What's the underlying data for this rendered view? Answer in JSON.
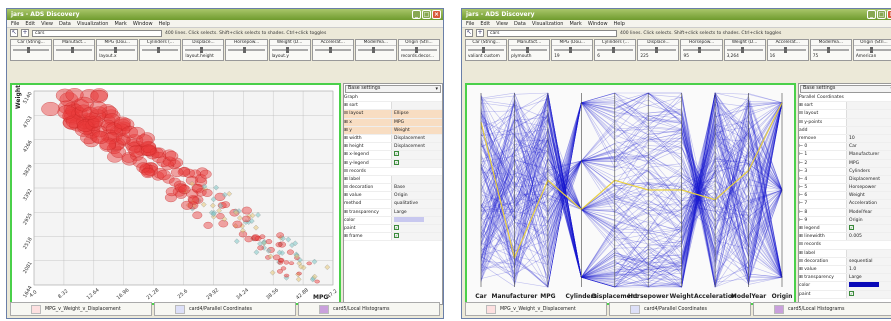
{
  "left": {
    "title": "jars - ADS Discovery",
    "menu": [
      "File",
      "Edit",
      "View",
      "Data",
      "Visualization",
      "Mark",
      "Window",
      "Help"
    ],
    "search": "cars",
    "hint": "400 lines. Click selects. Shift+click selects to shades. Ctrl+click toggles",
    "columns": [
      {
        "name": "Car (String...",
        "value": ""
      },
      {
        "name": "Manufact...",
        "value": ""
      },
      {
        "name": "MPG (Dou...",
        "value": "layout.x"
      },
      {
        "name": "Cylinders (...",
        "value": ""
      },
      {
        "name": "Displace...",
        "value": "layout.height"
      },
      {
        "name": "Horsepow...",
        "value": ""
      },
      {
        "name": "Weight (D...",
        "value": "layout.y"
      },
      {
        "name": "Accelerat...",
        "value": ""
      },
      {
        "name": "ModelYea...",
        "value": ""
      },
      {
        "name": "Origin (Stri...",
        "value": "records.decor..."
      }
    ],
    "settings_head": "Base settings",
    "tree": [
      {
        "k": "Graph",
        "v": "",
        "hdr": true
      },
      {
        "k": "⊞ sort",
        "v": ""
      },
      {
        "k": "⊟ layout",
        "v": "Ellipse",
        "sel": true
      },
      {
        "k": "   ⊞ x",
        "v": "MPG",
        "sel": true
      },
      {
        "k": "   ⊞ y",
        "v": "Weight",
        "sel": true
      },
      {
        "k": "   ⊞ width",
        "v": "Displacement"
      },
      {
        "k": "   ⊞ height",
        "v": "Displacement"
      },
      {
        "k": "   ⊞ x-legend",
        "v": "✓",
        "chk": true
      },
      {
        "k": "   ⊞ y-legend",
        "v": "✓",
        "chk": true
      },
      {
        "k": "⊟ records",
        "v": "",
        "hdr": true
      },
      {
        "k": "   ⊞ label",
        "v": ""
      },
      {
        "k": "   ⊟ decoration",
        "v": "Base"
      },
      {
        "k": "      ⊞ value",
        "v": "Origin"
      },
      {
        "k": "        method",
        "v": "qualitative"
      },
      {
        "k": "      ⊞ transparency",
        "v": "Large"
      },
      {
        "k": "        color",
        "v": "",
        "color": "#c8c8ef"
      },
      {
        "k": "        paint",
        "v": "✓",
        "chk": true
      },
      {
        "k": "   ⊞ frame",
        "v": "✓",
        "chk": true
      }
    ],
    "x_ticks": [
      "4.0",
      "8.32",
      "12.64",
      "16.96",
      "21.28",
      "25.6",
      "29.92",
      "34.24",
      "38.56",
      "42.88",
      "47.2"
    ],
    "y_ticks": [
      "5140",
      "4703",
      "4266",
      "3829",
      "3392",
      "2955",
      "2518",
      "2081",
      "1644"
    ],
    "x_axis_label": "MPG",
    "y_axis_label": "Weight",
    "tabs": [
      "MPG_v_Weight_v_Displacement",
      "card4/Parallel Coordinates",
      "card5/Local Histograms"
    ]
  },
  "right": {
    "title": "jars - ADS Discovery",
    "menu": [
      "File",
      "Edit",
      "View",
      "Data",
      "Visualization",
      "Mark",
      "Window",
      "Help"
    ],
    "search": "cars",
    "hint": "400 lines. Click selects. Shift+click selects to shades. Ctrl+click toggles",
    "columns": [
      {
        "name": "Car (String...",
        "value": "valiant custom"
      },
      {
        "name": "Manufact...",
        "value": "plymouth"
      },
      {
        "name": "MPG (Dou...",
        "value": "19"
      },
      {
        "name": "Cylinders (...",
        "value": "6"
      },
      {
        "name": "Displace...",
        "value": "225"
      },
      {
        "name": "Horsepow...",
        "value": "95"
      },
      {
        "name": "Weight (D...",
        "value": "3,264"
      },
      {
        "name": "Accelerat...",
        "value": "16"
      },
      {
        "name": "ModelYea...",
        "value": "75"
      },
      {
        "name": "Origin (Stri...",
        "value": "American"
      }
    ],
    "settings_head": "Base settings",
    "tree": [
      {
        "k": "Parallel Coordinates",
        "v": "",
        "hdr": true
      },
      {
        "k": "⊞ sort",
        "v": ""
      },
      {
        "k": "⊟ layout",
        "v": ""
      },
      {
        "k": "   ⊟ y-points",
        "v": ""
      },
      {
        "k": "      add",
        "v": ""
      },
      {
        "k": "      remove",
        "v": "10"
      },
      {
        "k": "      ⊢ 0",
        "v": "Car"
      },
      {
        "k": "      ⊢ 1",
        "v": "Manufacturer"
      },
      {
        "k": "      ⊢ 2",
        "v": "MPG"
      },
      {
        "k": "      ⊢ 3",
        "v": "Cylinders"
      },
      {
        "k": "      ⊢ 4",
        "v": "Displacement"
      },
      {
        "k": "      ⊢ 5",
        "v": "Horsepower"
      },
      {
        "k": "      ⊢ 6",
        "v": "Weight"
      },
      {
        "k": "      ⊢ 7",
        "v": "Acceleration"
      },
      {
        "k": "      ⊢ 8",
        "v": "ModelYear"
      },
      {
        "k": "      ⊢ 9",
        "v": "Origin"
      },
      {
        "k": "   ⊞ legend",
        "v": "✓",
        "chk": true
      },
      {
        "k": "   ⊞ linewidth",
        "v": "0.005"
      },
      {
        "k": "⊟ records",
        "v": "",
        "hdr": true
      },
      {
        "k": "   ⊞ label",
        "v": ""
      },
      {
        "k": "   ⊟ decoration",
        "v": "sequential"
      },
      {
        "k": "      ⊞ value",
        "v": "1.0"
      },
      {
        "k": "      ⊞ transparency",
        "v": "Large"
      },
      {
        "k": "        color",
        "v": "",
        "color": "#0a0ab8"
      },
      {
        "k": "        paint",
        "v": "✓",
        "chk": true
      }
    ],
    "axes": [
      "Car",
      "Manufacturer",
      "MPG",
      "Cylinders",
      "Displacement",
      "Horsepower",
      "Weight",
      "Acceleration",
      "ModelYear",
      "Origin"
    ],
    "tabs": [
      "MPG_v_Weight_v_Displacement",
      "card4/Parallel Coordinates",
      "card5/Local Histograms"
    ]
  },
  "colors": {
    "plot_border": "#4ad04a",
    "scatter_american": "#e83a3a",
    "scatter_european": "#7fc8c8",
    "scatter_japanese": "#e8c87a",
    "parallel_lines": "#1a1ad0",
    "highlight_line": "#e8d040"
  }
}
